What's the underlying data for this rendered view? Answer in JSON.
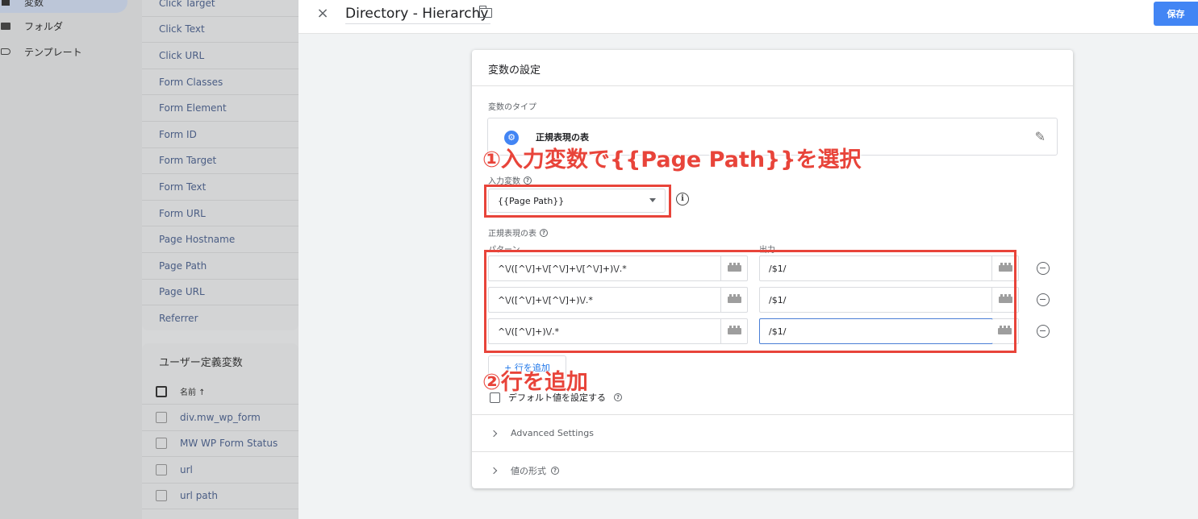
{
  "sidebar": {
    "items": [
      {
        "label": "変数",
        "icon": "variables-icon"
      },
      {
        "label": "フォルダ",
        "icon": "folder-icon"
      },
      {
        "label": "テンプレート",
        "icon": "template-tag-icon"
      }
    ]
  },
  "builtin_variables": [
    "Click Target",
    "Click Text",
    "Click URL",
    "Form Classes",
    "Form Element",
    "Form ID",
    "Form Target",
    "Form Text",
    "Form URL",
    "Page Hostname",
    "Page Path",
    "Page URL",
    "Referrer"
  ],
  "user_variables": {
    "title": "ユーザー定義変数",
    "column_header": "名前 ↑",
    "rows": [
      "div.mw_wp_form",
      "MW WP Form Status",
      "url",
      "url path"
    ]
  },
  "editor": {
    "close_icon": "×",
    "title": "Directory - Hierarchy",
    "save_label": "保存"
  },
  "config": {
    "card_title": "変数の設定",
    "type_label": "変数のタイプ",
    "type_name": "正規表現の表",
    "input_label": "入力変数",
    "input_value": "{{Page Path}}",
    "table_label": "正規表現の表",
    "pattern_header": "パターン",
    "output_header": "出力",
    "rows": [
      {
        "pattern": "^\\/([^\\/]+\\/[^\\/]+\\/[^\\/]+)\\/.*",
        "output": "/$1/"
      },
      {
        "pattern": "^\\/([^\\/]+\\/[^\\/]+)\\/.*",
        "output": "/$1/"
      },
      {
        "pattern": "^\\/([^\\/]+)\\/.*",
        "output": "/$1/"
      }
    ],
    "add_row_label": "+ 行を追加",
    "default_value_label": "デフォルト値を設定する",
    "advanced_label": "Advanced Settings",
    "format_label": "値の形式"
  },
  "annotations": {
    "step1": "①入力変数で{{Page Path}}を選択",
    "step2": "②行を追加"
  },
  "colors": {
    "accent": "#4285f4",
    "annotation_red": "#e8443a"
  }
}
